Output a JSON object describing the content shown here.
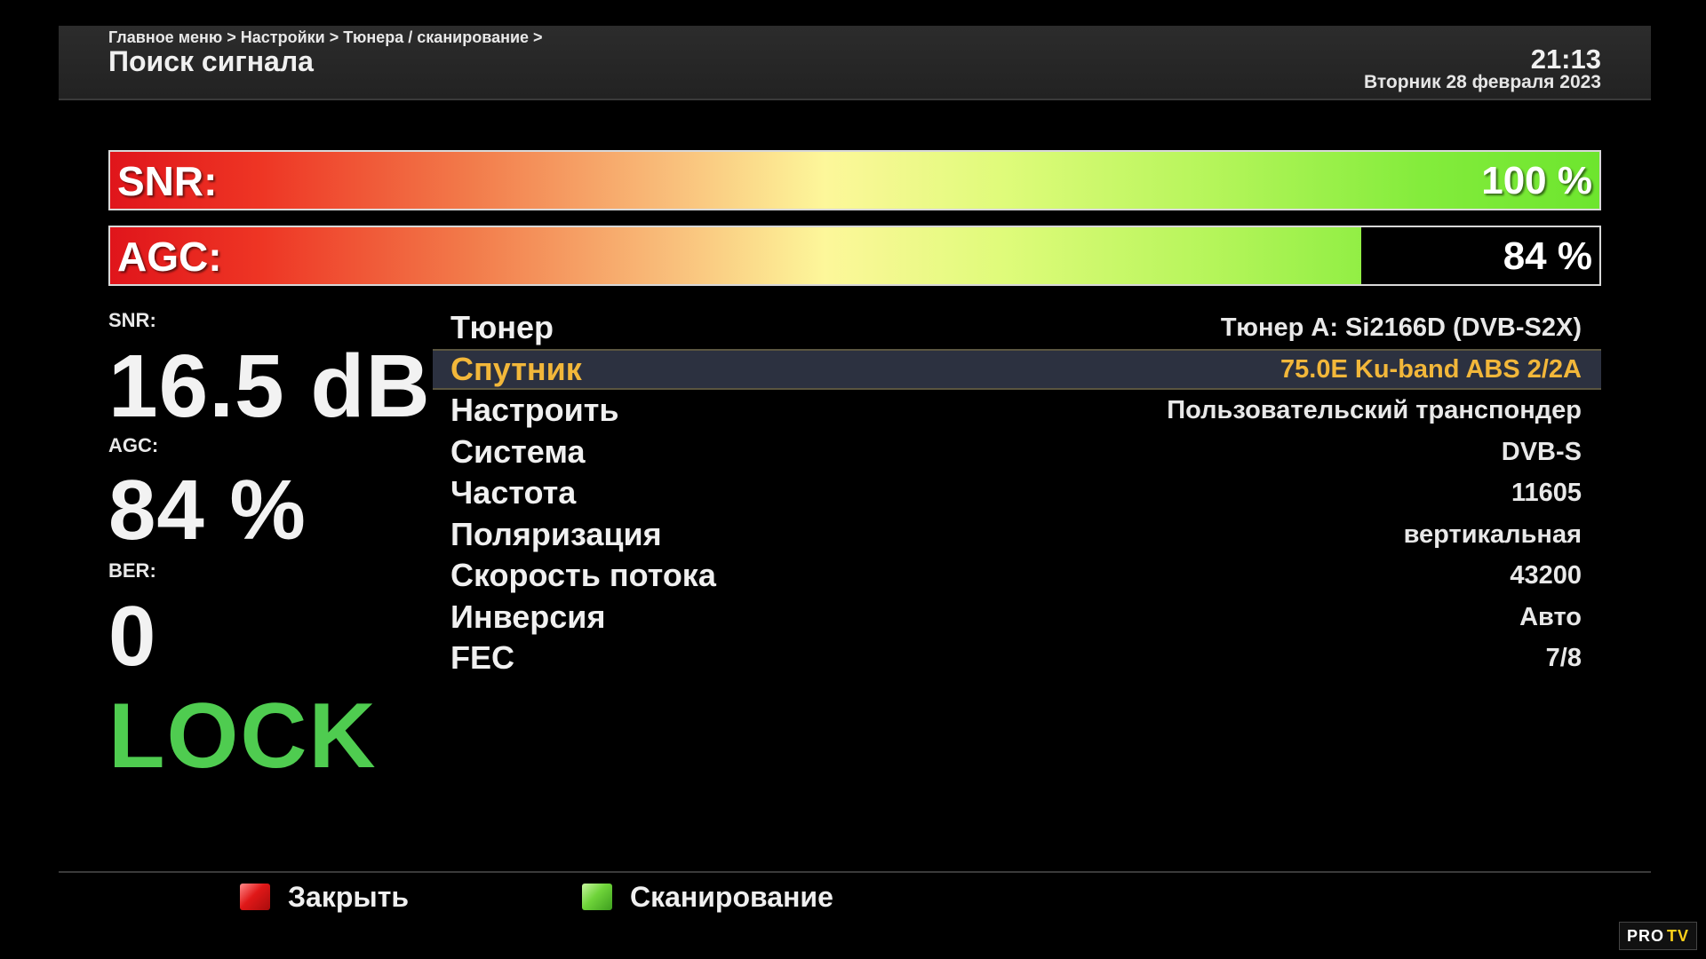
{
  "header": {
    "breadcrumb": "Главное меню > Настройки > Тюнера / сканирование >",
    "title": "Поиск сигнала",
    "time": "21:13",
    "date": "Вторник 28 февраля 2023"
  },
  "bars": {
    "snr": {
      "label": "SNR:",
      "value": "100 %",
      "level": 1.0
    },
    "agc": {
      "label": "AGC:",
      "value": "84 %",
      "level": 0.84
    }
  },
  "stats": {
    "snr_label": "SNR:",
    "snr_value": "16.5 dB",
    "agc_label": "AGC:",
    "agc_value": "84 %",
    "ber_label": "BER:",
    "ber_value": "0",
    "lock": "LOCK"
  },
  "settings": [
    {
      "label": "Тюнер",
      "value": "Тюнер A: Si2166D (DVB-S2X)"
    },
    {
      "label": "Спутник",
      "value": "75.0E Ku-band ABS 2/2A"
    },
    {
      "label": "Настроить",
      "value": "Пользовательский транспондер"
    },
    {
      "label": "Система",
      "value": "DVB-S"
    },
    {
      "label": "Частота",
      "value": "11605"
    },
    {
      "label": "Поляризация",
      "value": "вертикальная"
    },
    {
      "label": "Скорость потока",
      "value": "43200"
    },
    {
      "label": "Инверсия",
      "value": "Авто"
    },
    {
      "label": "FEC",
      "value": "7/8"
    }
  ],
  "footer": {
    "red_label": "Закрыть",
    "green_label": "Сканирование"
  },
  "colors": {
    "lock": "#4fcc50",
    "selected_text": "#f2b73a",
    "red_key": "#e01818",
    "green_key": "#6fd43a"
  },
  "icons": [
    "red-key-icon",
    "green-key-icon"
  ],
  "watermark": {
    "pro": "PRO",
    "tv": "TV"
  }
}
